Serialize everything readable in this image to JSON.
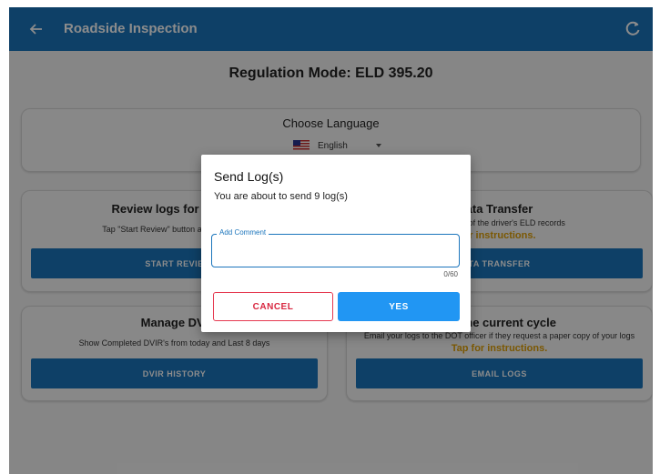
{
  "colors": {
    "primary": "#1b75bc",
    "accent_yes": "#2196f3",
    "cancel": "#e53950",
    "link": "#e0a106"
  },
  "appbar": {
    "title": "Roadside Inspection",
    "back_icon": "arrow-left-icon",
    "refresh_icon": "refresh-icon"
  },
  "regulation_mode": "Regulation Mode: ELD 395.20",
  "language": {
    "title": "Choose Language",
    "selected": "English",
    "flag_icon": "us-flag-icon"
  },
  "cards": {
    "review": {
      "title": "Review logs for the cu",
      "desc": "Tap \"Start Review\" button and give your",
      "button": "START REVIE"
    },
    "transfer": {
      "title": "ata Transfer",
      "desc": "mpilation of the driver's ELD records",
      "link": "or instructions.",
      "button": "TA TRANSFER"
    },
    "dvir": {
      "title": "Manage DVI",
      "desc": "Show Completed DVIR's from today and Last 8 days",
      "button": "DVIR HISTORY"
    },
    "email": {
      "title": "for the current cycle",
      "desc": "Email your logs to the DOT officer if they request a paper copy of your logs",
      "link": "Tap for instructions.",
      "button": "EMAIL LOGS"
    }
  },
  "dialog": {
    "title": "Send Log(s)",
    "message": "You are about to send 9 log(s)",
    "comment_label": "Add Comment",
    "comment_value": "",
    "counter": "0/60",
    "cancel": "CANCEL",
    "yes": "YES"
  }
}
